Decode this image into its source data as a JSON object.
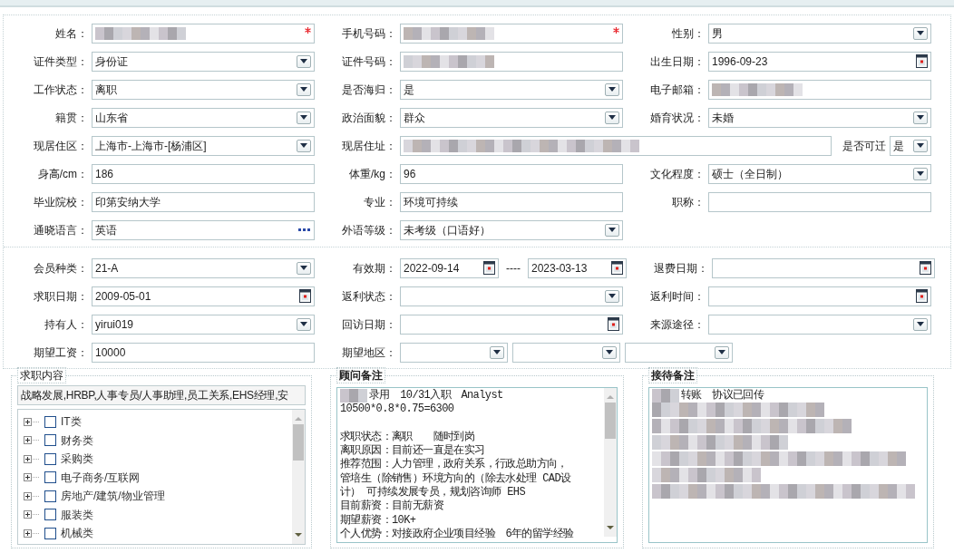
{
  "form_sections": [
    {
      "rows": [
        {
          "items": [
            {
              "kind": "standard",
              "label": "姓名：",
              "fields": [
                {
                  "kind": "text",
                  "redacted": true,
                  "required": true
                }
              ]
            },
            {
              "kind": "standard",
              "label": "手机号码：",
              "fields": [
                {
                  "kind": "text",
                  "redacted": true,
                  "required": true
                }
              ]
            },
            {
              "kind": "standard",
              "label": "性别：",
              "fields": [
                {
                  "kind": "select",
                  "value": "男"
                }
              ]
            }
          ]
        },
        {
          "items": [
            {
              "kind": "standard",
              "label": "证件类型：",
              "fields": [
                {
                  "kind": "select",
                  "value": "身份证"
                }
              ]
            },
            {
              "kind": "standard",
              "label": "证件号码：",
              "fields": [
                {
                  "kind": "text",
                  "redacted": true
                }
              ]
            },
            {
              "kind": "standard",
              "label": "出生日期：",
              "fields": [
                {
                  "kind": "date",
                  "value": "1996-09-23"
                }
              ]
            }
          ]
        },
        {
          "items": [
            {
              "kind": "standard",
              "label": "工作状态：",
              "fields": [
                {
                  "kind": "select",
                  "value": "离职"
                }
              ]
            },
            {
              "kind": "standard",
              "label": "是否海归：",
              "fields": [
                {
                  "kind": "select",
                  "value": "是"
                }
              ]
            },
            {
              "kind": "standard",
              "label": "电子邮箱：",
              "fields": [
                {
                  "kind": "text",
                  "redacted": true
                }
              ]
            }
          ]
        },
        {
          "items": [
            {
              "kind": "standard",
              "label": "籍贯：",
              "fields": [
                {
                  "kind": "select",
                  "value": "山东省"
                }
              ]
            },
            {
              "kind": "standard",
              "label": "政治面貌：",
              "fields": [
                {
                  "kind": "select",
                  "value": "群众"
                }
              ]
            },
            {
              "kind": "standard",
              "label": "婚育状况：",
              "fields": [
                {
                  "kind": "select",
                  "value": "未婚"
                }
              ]
            }
          ]
        },
        {
          "items": [
            {
              "kind": "standard",
              "label": "现居住区：",
              "fields": [
                {
                  "kind": "select",
                  "value": "上海市-上海市-[杨浦区]"
                }
              ]
            },
            {
              "kind": "wide",
              "label": "现居住址：",
              "fields": [
                {
                  "kind": "text",
                  "redacted": true
                }
              ]
            },
            {
              "kind": "compact",
              "label": "是否可迁",
              "fields": [
                {
                  "kind": "select",
                  "value": "是"
                }
              ]
            }
          ]
        },
        {
          "items": [
            {
              "kind": "standard",
              "label": "身高/cm：",
              "fields": [
                {
                  "kind": "text",
                  "value": "186"
                }
              ]
            },
            {
              "kind": "standard",
              "label": "体重/kg：",
              "fields": [
                {
                  "kind": "text",
                  "value": "96"
                }
              ]
            },
            {
              "kind": "standard",
              "label": "文化程度：",
              "fields": [
                {
                  "kind": "select",
                  "value": "硕士（全日制）"
                }
              ]
            }
          ]
        },
        {
          "items": [
            {
              "kind": "standard",
              "label": "毕业院校：",
              "fields": [
                {
                  "kind": "text",
                  "value": "印第安纳大学"
                }
              ]
            },
            {
              "kind": "standard",
              "label": "专业：",
              "fields": [
                {
                  "kind": "text",
                  "value": "环境可持续"
                }
              ]
            },
            {
              "kind": "standard",
              "label": "职称：",
              "fields": [
                {
                  "kind": "text"
                }
              ]
            }
          ]
        },
        {
          "items": [
            {
              "kind": "standard",
              "label": "通晓语言：",
              "fields": [
                {
                  "kind": "lookup",
                  "value": "英语"
                }
              ]
            },
            {
              "kind": "standard",
              "label": "外语等级：",
              "fields": [
                {
                  "kind": "select",
                  "value": "未考级（口语好）"
                }
              ]
            }
          ]
        }
      ]
    },
    {
      "rows": [
        {
          "items": [
            {
              "kind": "standard",
              "label": "会员种类：",
              "fields": [
                {
                  "kind": "select",
                  "value": "21-A"
                }
              ]
            },
            {
              "kind": "standard",
              "label": "有效期：",
              "separator": "----",
              "fields": [
                {
                  "kind": "date",
                  "value": "2022-09-14"
                },
                {
                  "kind": "date",
                  "value": "2023-03-13"
                }
              ]
            },
            {
              "kind": "standard",
              "label": "退费日期：",
              "fields": [
                {
                  "kind": "date"
                }
              ]
            }
          ]
        },
        {
          "items": [
            {
              "kind": "standard",
              "label": "求职日期：",
              "fields": [
                {
                  "kind": "date",
                  "value": "2009-05-01"
                }
              ]
            },
            {
              "kind": "standard",
              "label": "返利状态：",
              "fields": [
                {
                  "kind": "select"
                }
              ]
            },
            {
              "kind": "standard",
              "label": "返利时间：",
              "fields": [
                {
                  "kind": "date"
                }
              ]
            }
          ]
        },
        {
          "items": [
            {
              "kind": "standard",
              "label": "持有人：",
              "fields": [
                {
                  "kind": "select",
                  "value": "yirui019"
                }
              ]
            },
            {
              "kind": "standard",
              "label": "回访日期：",
              "fields": [
                {
                  "kind": "date"
                }
              ]
            },
            {
              "kind": "standard",
              "label": "来源途径：",
              "fields": [
                {
                  "kind": "select"
                }
              ]
            }
          ]
        },
        {
          "items": [
            {
              "kind": "standard",
              "label": "期望工资：",
              "fields": [
                {
                  "kind": "text",
                  "value": "10000"
                }
              ]
            },
            {
              "kind": "standard",
              "label": "期望地区：",
              "fields": [
                {
                  "kind": "select"
                },
                {
                  "kind": "select"
                },
                {
                  "kind": "select"
                }
              ]
            }
          ]
        }
      ]
    }
  ],
  "job_intent": {
    "title": "求职内容",
    "emphasis": false,
    "summary": "战略发展,HRBP,人事专员/人事助理,员工关系,EHS经理,安",
    "categories": [
      {
        "label": "IT类",
        "expanded": false,
        "checked": false
      },
      {
        "label": "财务类",
        "expanded": false,
        "checked": false
      },
      {
        "label": "采购类",
        "expanded": false,
        "checked": false
      },
      {
        "label": "电子商务/互联网",
        "expanded": false,
        "checked": false
      },
      {
        "label": "房地产/建筑/物业管理",
        "expanded": false,
        "checked": false
      },
      {
        "label": "服装类",
        "expanded": false,
        "checked": false
      },
      {
        "label": "机械类",
        "expanded": false,
        "checked": false
      }
    ]
  },
  "notes_panels": [
    {
      "title": "顾问备注",
      "emphasis": true,
      "lines": [
        {
          "kind": "text",
          "redacted": true,
          "text": "录用　10/31入职　Analyst"
        },
        {
          "kind": "text",
          "text": "10500*0.8*0.75=6300"
        },
        {
          "kind": "text",
          "gap_before": true,
          "text": "求职状态：离职　　随时到岗"
        },
        {
          "kind": "text",
          "text": "离职原因：目前还一直是在实习"
        },
        {
          "kind": "text",
          "text": "推荐范围：人力管理，政府关系，行政总助方向，"
        },
        {
          "kind": "text",
          "text": "管培生（除销售）环境方向的（除去水处理 CAD设"
        },
        {
          "kind": "text",
          "text": "计） 可持续发展专员，规划咨询师 EHS"
        },
        {
          "kind": "text",
          "text": "目前薪资：目前无薪资"
        },
        {
          "kind": "text",
          "text": "期望薪资：10K+"
        },
        {
          "kind": "text",
          "text": "个人优势：对接政府企业项目经验　6年的留学经验"
        }
      ]
    },
    {
      "title": "接待备注",
      "emphasis": true,
      "lines": [
        {
          "kind": "text",
          "redacted": true,
          "text": "转账　协议已回传"
        },
        {
          "kind": "blurred"
        },
        {
          "kind": "blurred"
        },
        {
          "kind": "blurred"
        },
        {
          "kind": "blurred"
        },
        {
          "kind": "blurred"
        },
        {
          "kind": "blurred"
        }
      ]
    }
  ]
}
